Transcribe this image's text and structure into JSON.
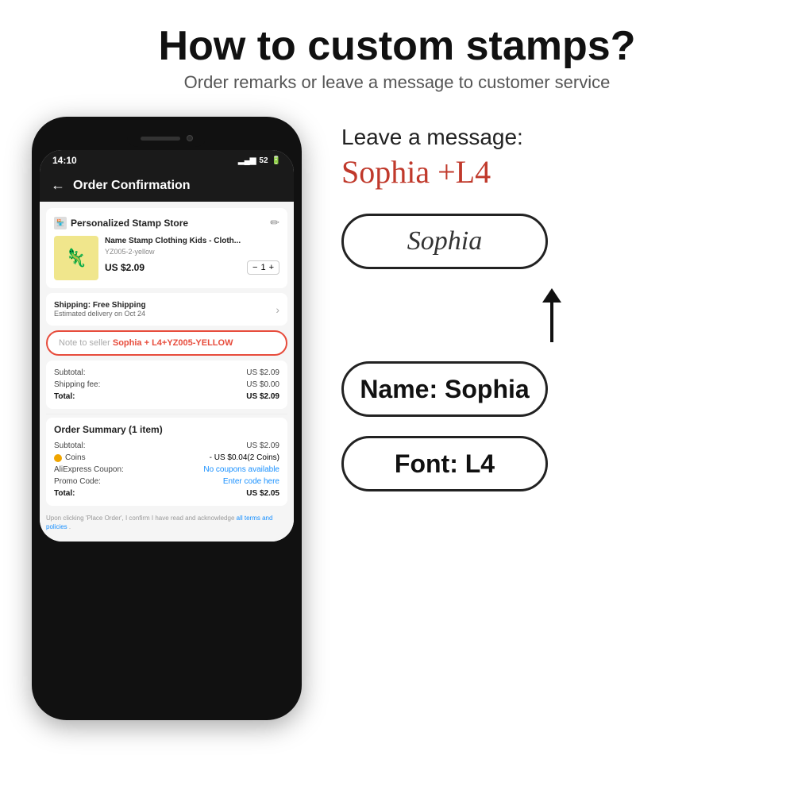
{
  "header": {
    "main_title": "How to custom stamps?",
    "subtitle": "Order remarks or leave a message to customer service"
  },
  "phone": {
    "status_bar": {
      "time": "14:10",
      "signal": "52",
      "battery": ")"
    },
    "nav": {
      "back_icon": "←",
      "title": "Order Confirmation"
    },
    "store": {
      "name": "Personalized Stamp Store",
      "edit_icon": "✏"
    },
    "product": {
      "name": "Name Stamp Clothing Kids - Cloth...",
      "sku": "YZ005-2-yellow",
      "price": "US $2.09",
      "qty": "1",
      "qty_minus": "−",
      "qty_plus": "+"
    },
    "shipping": {
      "label": "Shipping:",
      "type": "Free Shipping",
      "estimated": "Estimated delivery on Oct 24",
      "arrow": "›"
    },
    "note": {
      "placeholder": "Note to seller",
      "highlight": "Sophia + L4+YZ005-YELLOW"
    },
    "totals": {
      "subtotal_label": "Subtotal:",
      "subtotal_value": "US $2.09",
      "shipping_label": "Shipping fee:",
      "shipping_value": "US $0.00",
      "total_label": "Total:",
      "total_value": "US $2.09"
    },
    "order_summary": {
      "title": "Order Summary (1 item)",
      "subtotal_label": "Subtotal:",
      "subtotal_value": "US $2.09",
      "coins_label": "Coins",
      "coins_value": "- US $0.04(2 Coins)",
      "aliexpress_coupon_label": "AliExpress Coupon:",
      "aliexpress_coupon_value": "No coupons available",
      "promo_label": "Promo Code:",
      "promo_value": "Enter code here",
      "total_label": "Total:",
      "total_value": "US $2.05"
    },
    "fine_print": "Upon clicking 'Place Order', I confirm I have read and acknowledge ",
    "fine_print_link": "all terms and policies",
    "fine_print_end": "."
  },
  "right_panel": {
    "leave_message_label": "Leave a message:",
    "message_value": "Sophia +L4",
    "stamp_preview_text": "Sophia",
    "name_box_text": "Name: Sophia",
    "font_box_text": "Font: L4"
  },
  "icons": {
    "store_icon": "🏪",
    "coin_icon": "●",
    "product_emoji": "🦎"
  }
}
